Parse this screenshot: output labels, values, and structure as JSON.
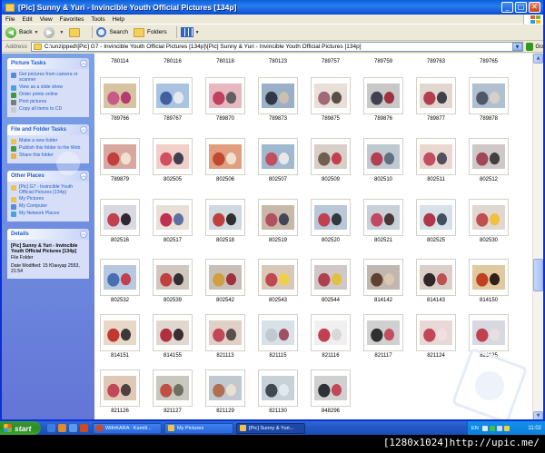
{
  "window": {
    "title": "[Pic] Sunny & Yuri - Invincible Youth Official Pictures [134p]",
    "min": "_",
    "max": "□",
    "close": "✕"
  },
  "menu": [
    "File",
    "Edit",
    "View",
    "Favorites",
    "Tools",
    "Help"
  ],
  "toolbar": {
    "back_label": "Back",
    "search_label": "Search",
    "folders_label": "Folders"
  },
  "address": {
    "label": "Address",
    "value": "C:\\unzipped\\[Pic] G7 - Invincible Youth Official Pictures [134p]\\[Pic] Sunny & Yuri - Invincible Youth Official Pictures [134p]",
    "go_label": "Go"
  },
  "sidebar": {
    "picture_tasks": {
      "title": "Picture Tasks",
      "items": [
        {
          "label": "Get pictures from camera or scanner",
          "icon": "camera-icon",
          "color": "#5a8bd8"
        },
        {
          "label": "View as a slide show",
          "icon": "slideshow-icon",
          "color": "#4aa3df"
        },
        {
          "label": "Order prints online",
          "icon": "globe-icon",
          "color": "#3f9a3a"
        },
        {
          "label": "Print pictures",
          "icon": "printer-icon",
          "color": "#7a7a7a"
        },
        {
          "label": "Copy all items to CD",
          "icon": "cd-icon",
          "color": "#c9c9c9"
        }
      ]
    },
    "file_tasks": {
      "title": "File and Folder Tasks",
      "items": [
        {
          "label": "Make a new folder",
          "icon": "new-folder-icon",
          "color": "#f0c24a"
        },
        {
          "label": "Publish this folder to the Web",
          "icon": "publish-web-icon",
          "color": "#3f9a3a"
        },
        {
          "label": "Share this folder",
          "icon": "share-icon",
          "color": "#e8b640"
        }
      ]
    },
    "other_places": {
      "title": "Other Places",
      "items": [
        {
          "label": "[Pic] G7 - Invincible Youth Official Pictures [134p]",
          "icon": "folder-icon",
          "color": "#f0c24a"
        },
        {
          "label": "My Pictures",
          "icon": "my-pictures-icon",
          "color": "#f0c24a"
        },
        {
          "label": "My Computer",
          "icon": "my-computer-icon",
          "color": "#5a8bd8"
        },
        {
          "label": "My Network Places",
          "icon": "network-icon",
          "color": "#4aa3df"
        }
      ]
    },
    "details": {
      "title": "Details",
      "name": "[Pic] Sunny & Yuri - Invincible Youth Official Pictures [134p]",
      "type": "File Folder",
      "modified": "Date Modified: 15 Юануар 2553, 21:54"
    }
  },
  "top_row_labels": [
    "780114",
    "780116",
    "780118",
    "780123",
    "789757",
    "789759",
    "789763",
    "789765"
  ],
  "thumbnails": [
    {
      "label": "789766",
      "colors": [
        "#d6c3a0",
        "#c85a8a",
        "#b53a70"
      ]
    },
    {
      "label": "789767",
      "colors": [
        "#a8c4e0",
        "#4060a0",
        "#e8e8f0"
      ]
    },
    {
      "label": "789870",
      "colors": [
        "#e8b8c0",
        "#c04060",
        "#606060"
      ]
    },
    {
      "label": "789873",
      "colors": [
        "#9ab0c8",
        "#303848",
        "#c8c0b0"
      ]
    },
    {
      "label": "789875",
      "colors": [
        "#e8e0d8",
        "#a06878",
        "#585048"
      ]
    },
    {
      "label": "789876",
      "colors": [
        "#c8c8c8",
        "#404050",
        "#a03040"
      ]
    },
    {
      "label": "789877",
      "colors": [
        "#e0d8d0",
        "#b04050",
        "#404048"
      ]
    },
    {
      "label": "789878",
      "colors": [
        "#b0c0d0",
        "#505868",
        "#d8d0c8"
      ]
    },
    {
      "label": "789879",
      "colors": [
        "#d8a8a0",
        "#c04040",
        "#f0e0d0"
      ]
    },
    {
      "label": "802505",
      "colors": [
        "#f0d0c8",
        "#d05060",
        "#404050"
      ]
    },
    {
      "label": "802506",
      "colors": [
        "#e0a080",
        "#c04830",
        "#f0e0d0"
      ]
    },
    {
      "label": "802507",
      "colors": [
        "#a0b8d0",
        "#c05060",
        "#e8e8e8"
      ]
    },
    {
      "label": "802509",
      "colors": [
        "#d8d0c8",
        "#706050",
        "#c04050"
      ]
    },
    {
      "label": "802510",
      "colors": [
        "#c0c8d0",
        "#b04050",
        "#607080"
      ]
    },
    {
      "label": "802511",
      "colors": [
        "#e8d8d0",
        "#c05060",
        "#505060"
      ]
    },
    {
      "label": "802512",
      "colors": [
        "#d0c8c8",
        "#a04858",
        "#404040"
      ]
    },
    {
      "label": "802516",
      "colors": [
        "#d8d8e0",
        "#c04050",
        "#302830"
      ]
    },
    {
      "label": "802517",
      "colors": [
        "#e8e0d8",
        "#c03050",
        "#6070a0"
      ]
    },
    {
      "label": "802518",
      "colors": [
        "#d0d8e0",
        "#c04040",
        "#303030"
      ]
    },
    {
      "label": "802519",
      "colors": [
        "#c8b8a8",
        "#b05060",
        "#404858"
      ]
    },
    {
      "label": "802520",
      "colors": [
        "#b8c8d8",
        "#c04050",
        "#303840"
      ]
    },
    {
      "label": "802521",
      "colors": [
        "#c8d0d8",
        "#c04860",
        "#483838"
      ]
    },
    {
      "label": "802525",
      "colors": [
        "#d8e0e8",
        "#b03848",
        "#405060"
      ]
    },
    {
      "label": "802530",
      "colors": [
        "#e0d8d0",
        "#c05050",
        "#f0c040"
      ]
    },
    {
      "label": "802532",
      "colors": [
        "#b8c8e0",
        "#4870b0",
        "#c04050"
      ]
    },
    {
      "label": "802539",
      "colors": [
        "#d0c8c0",
        "#c04040",
        "#303030"
      ]
    },
    {
      "label": "802542",
      "colors": [
        "#c8c0b8",
        "#d0a040",
        "#a03040"
      ]
    },
    {
      "label": "802543",
      "colors": [
        "#d8c8b8",
        "#c04850",
        "#f0d040"
      ]
    },
    {
      "label": "802544",
      "colors": [
        "#d0c8c8",
        "#b04050",
        "#e0c040"
      ]
    },
    {
      "label": "814142",
      "colors": [
        "#c0b8b0",
        "#604030",
        "#d8c8b0"
      ]
    },
    {
      "label": "814143",
      "colors": [
        "#d8d0c8",
        "#302828",
        "#c05050"
      ]
    },
    {
      "label": "814150",
      "colors": [
        "#e0c8a0",
        "#c04020",
        "#302018"
      ]
    },
    {
      "label": "814151",
      "colors": [
        "#e8d8c8",
        "#c03830",
        "#403838"
      ]
    },
    {
      "label": "814155",
      "colors": [
        "#e0d8d0",
        "#b03040",
        "#383030"
      ]
    },
    {
      "label": "821113",
      "colors": [
        "#e0d0c8",
        "#c04858",
        "#585048"
      ]
    },
    {
      "label": "821115",
      "colors": [
        "#d8e0e8",
        "#c0c8d0",
        "#a05060"
      ]
    },
    {
      "label": "821116",
      "colors": [
        "#f0f0f0",
        "#c04050",
        "#d8d8d8"
      ]
    },
    {
      "label": "821117",
      "colors": [
        "#d0d0d0",
        "#303030",
        "#c05060"
      ]
    },
    {
      "label": "821124",
      "colors": [
        "#e8d8d8",
        "#c04858",
        "#f0e0e0"
      ]
    },
    {
      "label": "821125",
      "colors": [
        "#d8d8e0",
        "#c04050",
        "#e8e0e0"
      ]
    },
    {
      "label": "821126",
      "colors": [
        "#e0c8b8",
        "#c04858",
        "#504040"
      ]
    },
    {
      "label": "821127",
      "colors": [
        "#c8c8c0",
        "#c05040",
        "#707060"
      ]
    },
    {
      "label": "821129",
      "colors": [
        "#c0c8d0",
        "#b07050",
        "#e8e0d0"
      ]
    },
    {
      "label": "821130",
      "colors": [
        "#c8d0d8",
        "#404850",
        "#e0e8f0"
      ]
    },
    {
      "label": "848296",
      "colors": [
        "#d0d0d0",
        "#303038",
        "#c04858"
      ]
    }
  ],
  "taskbar": {
    "start_label": "start",
    "tasks": [
      {
        "label": "WithKARA : Kamili...",
        "icon_color": "#d04a20",
        "active": false
      },
      {
        "label": "My Pictures",
        "icon_color": "#f0c24a",
        "active": false
      },
      {
        "label": "[Pic] Sunny & Yuri...",
        "icon_color": "#f0c24a",
        "active": true
      }
    ],
    "lang": "EN",
    "clock": "11:02"
  },
  "caption": "[1280x1024]http://upic.me/"
}
